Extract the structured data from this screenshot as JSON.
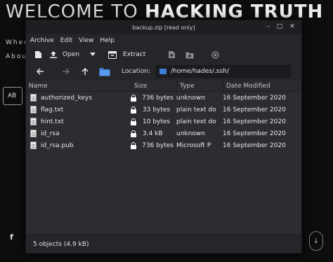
{
  "background_page": {
    "title_part1": "WELCOME TO ",
    "title_part2": "HACKING TRUTH",
    "line1": "When",
    "line2": "Abou",
    "button_label": "AB",
    "social_label": "f",
    "scroll_glyph": "↓"
  },
  "window": {
    "title": "backup.zip [read only]",
    "controls": {
      "minimize": "–",
      "maximize": "□",
      "close": "✕"
    }
  },
  "menu": [
    "Archive",
    "Edit",
    "View",
    "Help"
  ],
  "toolbar": {
    "new_icon": "new-archive-icon",
    "open_label": "Open",
    "open_dropdown_icon": "chevron-down-icon",
    "extract_label": "Extract",
    "add_files_icon": "add-files-icon",
    "add_folder_icon": "add-folder-icon",
    "stop_icon": "stop-icon"
  },
  "location": {
    "label": "Location:",
    "path": "/home/hades/.ssh/"
  },
  "columns": [
    "Name",
    "Size",
    "Type",
    "Date Modified"
  ],
  "files": [
    {
      "name": "authorized_keys",
      "size": "736 bytes",
      "type": "unknown",
      "date": "16 September 2020"
    },
    {
      "name": "flag.txt",
      "size": "33 bytes",
      "type": "plain text do",
      "date": "16 September 2020"
    },
    {
      "name": "hint.txt",
      "size": "10 bytes",
      "type": "plain text do",
      "date": "16 September 2020"
    },
    {
      "name": "id_rsa",
      "size": "3.4 kB",
      "type": "unknown",
      "date": "16 September 2020"
    },
    {
      "name": "id_rsa.pub",
      "size": "736 bytes",
      "type": "Microsoft P",
      "date": "16 September 2020"
    }
  ],
  "status": "5 objects (4.9 kB)",
  "colors": {
    "accent": "#3d7fd8",
    "window_bg": "#252629",
    "list_bg": "#2c2d31"
  }
}
